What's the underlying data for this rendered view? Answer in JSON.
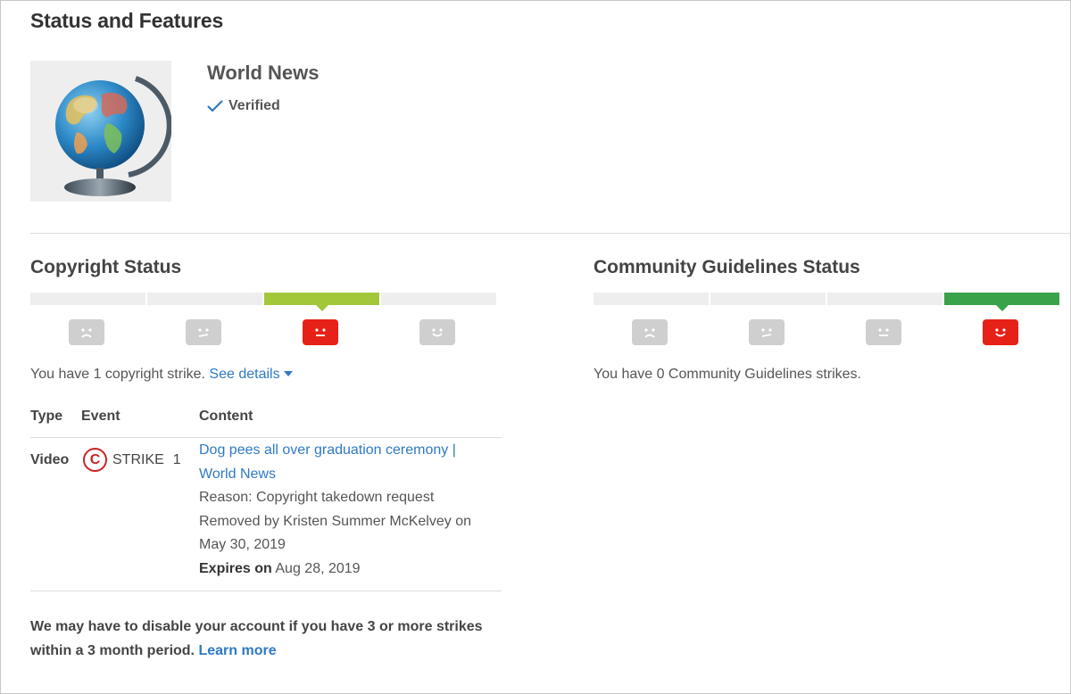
{
  "page_title": "Status and Features",
  "channel": {
    "name": "World News",
    "verified_label": "Verified",
    "thumbnail_icon": "globe-icon"
  },
  "copyright": {
    "title": "Copyright Status",
    "active_segment": 3,
    "segment_color": "#a2c83a",
    "summary_text": "You have 1 copyright strike.",
    "see_details_label": "See details",
    "table": {
      "headers": [
        "Type",
        "Event",
        "Content"
      ],
      "rows": [
        {
          "type": "Video",
          "event_label": "STRIKE",
          "event_count": "1",
          "video_title": "Dog pees all over graduation ceremony | World News",
          "reason": "Reason: Copyright takedown request",
          "removed_by": "Removed by Kristen Summer McKelvey on May 30, 2019",
          "expires_label": "Expires on",
          "expires_date": "Aug 28, 2019"
        }
      ]
    }
  },
  "community": {
    "title": "Community Guidelines Status",
    "active_segment": 4,
    "segment_color": "#3aa349",
    "summary_text": "You have 0 Community Guidelines strikes."
  },
  "footer": {
    "note": "We may have to disable your account if you have 3 or more strikes within a 3 month period.",
    "learn_more_label": "Learn more"
  },
  "colors": {
    "link": "#2f79c4",
    "strike_red": "#e62117",
    "face_gray": "#cfcfcf"
  }
}
